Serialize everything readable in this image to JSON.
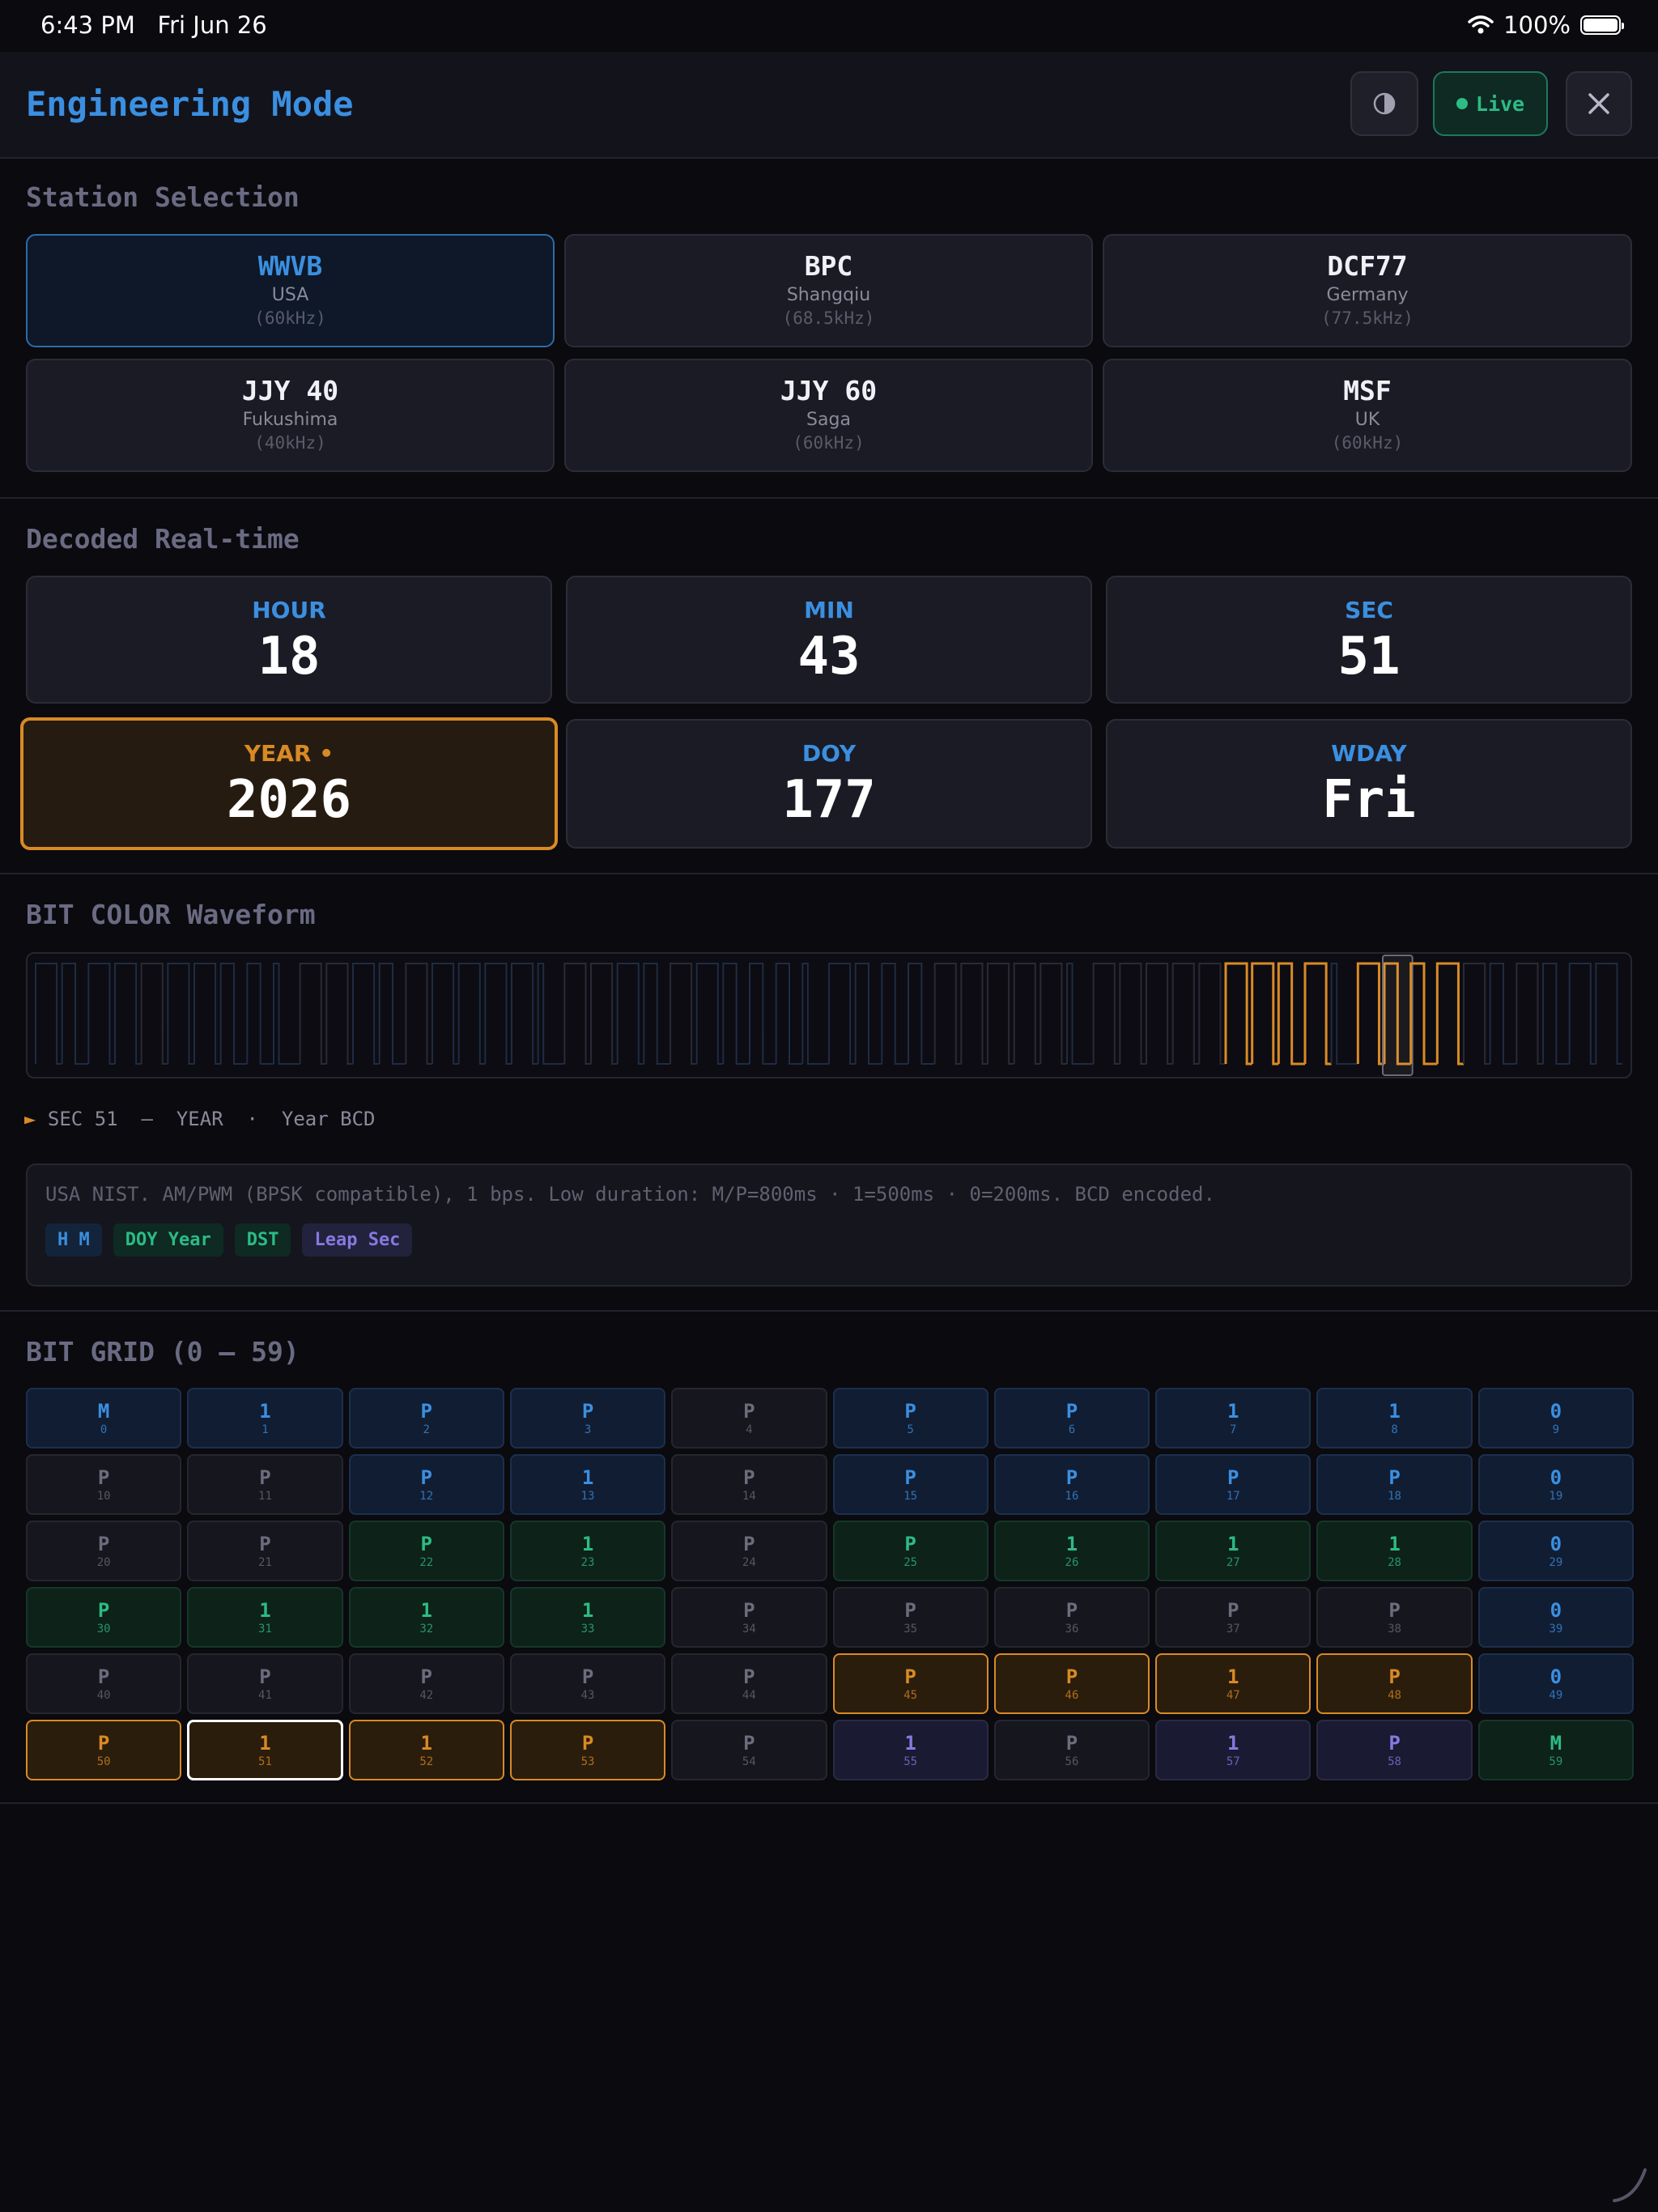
{
  "status_bar": {
    "time": "6:43 PM",
    "date": "Fri Jun 26",
    "battery": "100%"
  },
  "header": {
    "title": "Engineering Mode",
    "live_label": "Live",
    "theme_icon": "half-circle-icon",
    "close_icon": "close-icon"
  },
  "stations_section": {
    "title": "Station Selection",
    "selected": "WWVB",
    "items": [
      {
        "name": "WWVB",
        "location": "USA",
        "frequency": "(60kHz)"
      },
      {
        "name": "BPC",
        "location": "Shangqiu",
        "frequency": "(68.5kHz)"
      },
      {
        "name": "DCF77",
        "location": "Germany",
        "frequency": "(77.5kHz)"
      },
      {
        "name": "JJY 40",
        "location": "Fukushima",
        "frequency": "(40kHz)"
      },
      {
        "name": "JJY 60",
        "location": "Saga",
        "frequency": "(60kHz)"
      },
      {
        "name": "MSF",
        "location": "UK",
        "frequency": "(60kHz)"
      }
    ]
  },
  "decoded_section": {
    "title": "Decoded Real-time",
    "fields": [
      {
        "label": "HOUR",
        "value": "18"
      },
      {
        "label": "MIN",
        "value": "43"
      },
      {
        "label": "SEC",
        "value": "51"
      },
      {
        "label": "YEAR •",
        "value": "2026"
      },
      {
        "label": "DOY",
        "value": "177"
      },
      {
        "label": "WDAY",
        "value": "Fri"
      }
    ]
  },
  "waveform_section": {
    "title": "BIT COLOR Waveform",
    "cursor_arrow": "►",
    "cursor_text": "SEC 51  —  YEAR  ·  Year BCD",
    "description": "USA NIST. AM/PWM (BPSK compatible), 1 bps. Low duration: M/P=800ms · 1=500ms · 0=200ms. BCD encoded.",
    "tags": [
      "H M",
      "DOY Year",
      "DST",
      "Leap Sec"
    ],
    "colors": {
      "orange": "#d98a25",
      "blue": "#3b8fe0",
      "green": "#2dbb86",
      "purple": "#8878e0",
      "gray": "#6c6c7c"
    }
  },
  "grid_section": {
    "title": "BIT GRID (0 — 59)",
    "current_index": 51,
    "bits": [
      {
        "v": "M",
        "i": "0",
        "c": "blue"
      },
      {
        "v": "1",
        "i": "1",
        "c": "blue"
      },
      {
        "v": "P",
        "i": "2",
        "c": "blue"
      },
      {
        "v": "P",
        "i": "3",
        "c": "blue"
      },
      {
        "v": "P",
        "i": "4",
        "c": "gray"
      },
      {
        "v": "P",
        "i": "5",
        "c": "blue"
      },
      {
        "v": "P",
        "i": "6",
        "c": "blue"
      },
      {
        "v": "1",
        "i": "7",
        "c": "blue"
      },
      {
        "v": "1",
        "i": "8",
        "c": "blue"
      },
      {
        "v": "0",
        "i": "9",
        "c": "blue"
      },
      {
        "v": "P",
        "i": "10",
        "c": "gray"
      },
      {
        "v": "P",
        "i": "11",
        "c": "gray"
      },
      {
        "v": "P",
        "i": "12",
        "c": "blue"
      },
      {
        "v": "1",
        "i": "13",
        "c": "blue"
      },
      {
        "v": "P",
        "i": "14",
        "c": "gray"
      },
      {
        "v": "P",
        "i": "15",
        "c": "blue"
      },
      {
        "v": "P",
        "i": "16",
        "c": "blue"
      },
      {
        "v": "P",
        "i": "17",
        "c": "blue"
      },
      {
        "v": "P",
        "i": "18",
        "c": "blue"
      },
      {
        "v": "0",
        "i": "19",
        "c": "blue"
      },
      {
        "v": "P",
        "i": "20",
        "c": "gray"
      },
      {
        "v": "P",
        "i": "21",
        "c": "gray"
      },
      {
        "v": "P",
        "i": "22",
        "c": "green"
      },
      {
        "v": "1",
        "i": "23",
        "c": "green"
      },
      {
        "v": "P",
        "i": "24",
        "c": "gray"
      },
      {
        "v": "P",
        "i": "25",
        "c": "green"
      },
      {
        "v": "1",
        "i": "26",
        "c": "green"
      },
      {
        "v": "1",
        "i": "27",
        "c": "green"
      },
      {
        "v": "1",
        "i": "28",
        "c": "green"
      },
      {
        "v": "0",
        "i": "29",
        "c": "blue"
      },
      {
        "v": "P",
        "i": "30",
        "c": "green"
      },
      {
        "v": "1",
        "i": "31",
        "c": "green"
      },
      {
        "v": "1",
        "i": "32",
        "c": "green"
      },
      {
        "v": "1",
        "i": "33",
        "c": "green"
      },
      {
        "v": "P",
        "i": "34",
        "c": "gray"
      },
      {
        "v": "P",
        "i": "35",
        "c": "gray"
      },
      {
        "v": "P",
        "i": "36",
        "c": "gray"
      },
      {
        "v": "P",
        "i": "37",
        "c": "gray"
      },
      {
        "v": "P",
        "i": "38",
        "c": "gray"
      },
      {
        "v": "0",
        "i": "39",
        "c": "blue"
      },
      {
        "v": "P",
        "i": "40",
        "c": "gray"
      },
      {
        "v": "P",
        "i": "41",
        "c": "gray"
      },
      {
        "v": "P",
        "i": "42",
        "c": "gray"
      },
      {
        "v": "P",
        "i": "43",
        "c": "gray"
      },
      {
        "v": "P",
        "i": "44",
        "c": "gray"
      },
      {
        "v": "P",
        "i": "45",
        "c": "orange"
      },
      {
        "v": "P",
        "i": "46",
        "c": "orange"
      },
      {
        "v": "1",
        "i": "47",
        "c": "orange"
      },
      {
        "v": "P",
        "i": "48",
        "c": "orange"
      },
      {
        "v": "0",
        "i": "49",
        "c": "blue"
      },
      {
        "v": "P",
        "i": "50",
        "c": "orange"
      },
      {
        "v": "1",
        "i": "51",
        "c": "orange"
      },
      {
        "v": "1",
        "i": "52",
        "c": "orange"
      },
      {
        "v": "P",
        "i": "53",
        "c": "orange"
      },
      {
        "v": "P",
        "i": "54",
        "c": "gray"
      },
      {
        "v": "1",
        "i": "55",
        "c": "purple"
      },
      {
        "v": "P",
        "i": "56",
        "c": "gray"
      },
      {
        "v": "1",
        "i": "57",
        "c": "purple"
      },
      {
        "v": "P",
        "i": "58",
        "c": "purple"
      },
      {
        "v": "M",
        "i": "59",
        "c": "green"
      }
    ]
  }
}
